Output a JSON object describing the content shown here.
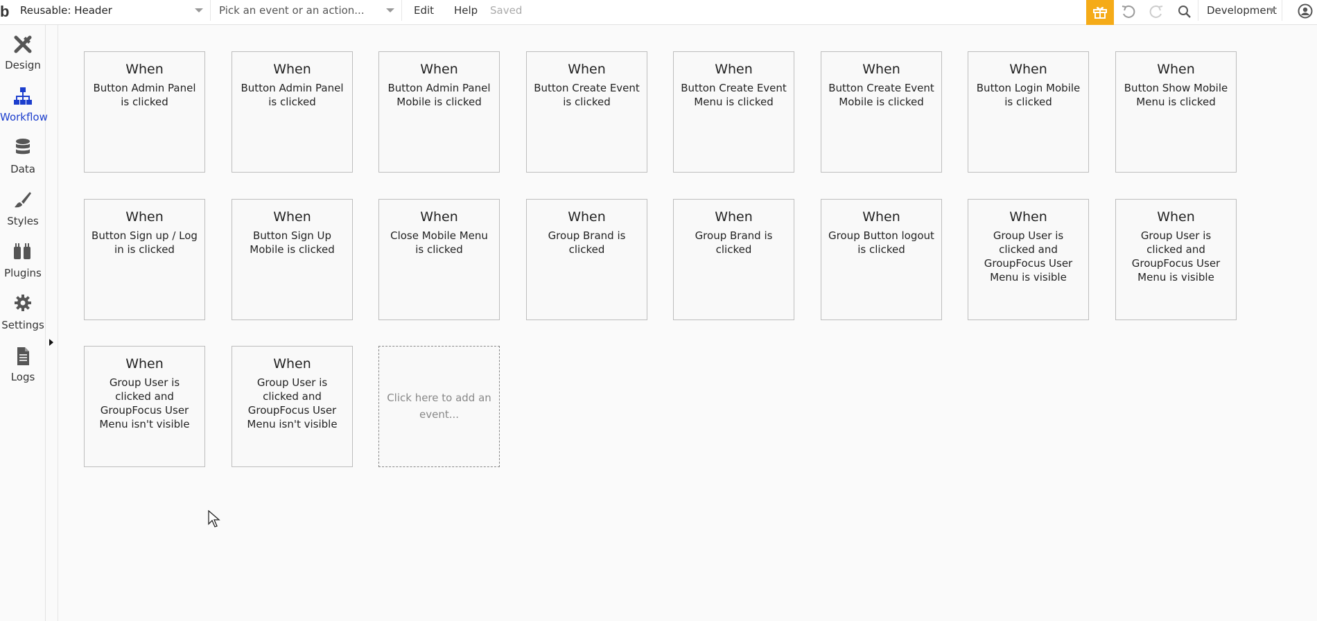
{
  "topbar": {
    "logo": "b",
    "page_select": "Reusable: Header",
    "event_placeholder": "Pick an event or an action...",
    "menu": [
      "Edit",
      "Help"
    ],
    "status": "Saved",
    "environment": "Development",
    "icons": [
      "gift-icon",
      "undo-icon",
      "redo-icon",
      "search-icon",
      "user-icon"
    ]
  },
  "sidebar": {
    "tabs": [
      {
        "label": "Design",
        "icon": "design-icon"
      },
      {
        "label": "Workflow",
        "icon": "workflow-icon",
        "active": true
      },
      {
        "label": "Data",
        "icon": "database-icon"
      },
      {
        "label": "Styles",
        "icon": "brush-icon"
      },
      {
        "label": "Plugins",
        "icon": "plug-icon"
      },
      {
        "label": "Settings",
        "icon": "gear-icon"
      },
      {
        "label": "Logs",
        "icon": "document-icon"
      }
    ]
  },
  "events": [
    {
      "when": "When",
      "desc": "Button Admin Panel is clicked"
    },
    {
      "when": "When",
      "desc": "Button Admin Panel is clicked"
    },
    {
      "when": "When",
      "desc": "Button Admin Panel Mobile is clicked"
    },
    {
      "when": "When",
      "desc": "Button Create Event is clicked"
    },
    {
      "when": "When",
      "desc": "Button Create Event Menu is clicked"
    },
    {
      "when": "When",
      "desc": "Button Create Event Mobile is clicked"
    },
    {
      "when": "When",
      "desc": "Button Login Mobile is clicked"
    },
    {
      "when": "When",
      "desc": "Button Show Mobile Menu is clicked"
    },
    {
      "when": "When",
      "desc": "Button Sign up / Log in is clicked"
    },
    {
      "when": "When",
      "desc": "Button Sign Up Mobile is clicked"
    },
    {
      "when": "When",
      "desc": "Close Mobile Menu is clicked"
    },
    {
      "when": "When",
      "desc": "Group Brand is clicked"
    },
    {
      "when": "When",
      "desc": "Group Brand is clicked"
    },
    {
      "when": "When",
      "desc": "Group Button logout is clicked"
    },
    {
      "when": "When",
      "desc": "Group User is clicked and GroupFocus User Menu is visible"
    },
    {
      "when": "When",
      "desc": "Group User is clicked and GroupFocus User Menu is visible"
    },
    {
      "when": "When",
      "desc": "Group User is clicked and GroupFocus User Menu isn't visible"
    },
    {
      "when": "When",
      "desc": "Group User is clicked and GroupFocus User Menu isn't visible"
    }
  ],
  "add_event": "Click here to add an event..."
}
